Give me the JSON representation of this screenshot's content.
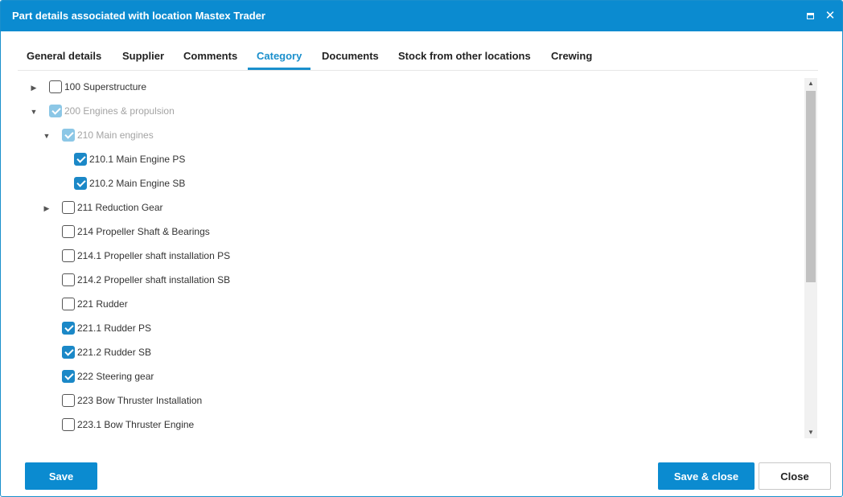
{
  "window": {
    "title": "Part details associated with location Mastex Trader",
    "maximize_icon": "maximize-icon",
    "close_icon": "close-icon",
    "close_glyph": "✕"
  },
  "tabs": [
    {
      "label": "General details",
      "active": false
    },
    {
      "label": "Supplier",
      "active": false
    },
    {
      "label": "Comments",
      "active": false
    },
    {
      "label": "Category",
      "active": true
    },
    {
      "label": "Documents",
      "active": false
    },
    {
      "label": "Stock from other locations",
      "active": false
    },
    {
      "label": "Crewing",
      "active": false
    }
  ],
  "tree": {
    "expand_glyph_collapsed": "▶",
    "expand_glyph_expanded": "▼",
    "items": [
      {
        "label": "100 Superstructure",
        "checked": false,
        "disabled": false,
        "expander": "collapsed"
      },
      {
        "label": "200 Engines & propulsion",
        "checked": true,
        "disabled": true,
        "expander": "expanded"
      },
      {
        "label": "210 Main engines",
        "checked": true,
        "disabled": true,
        "expander": "expanded"
      },
      {
        "label": "210.1 Main Engine PS",
        "checked": true,
        "disabled": false,
        "expander": "none"
      },
      {
        "label": "210.2 Main Engine SB",
        "checked": true,
        "disabled": false,
        "expander": "none"
      },
      {
        "label": "211 Reduction Gear",
        "checked": false,
        "disabled": false,
        "expander": "collapsed"
      },
      {
        "label": "214 Propeller Shaft & Bearings",
        "checked": false,
        "disabled": false,
        "expander": "none"
      },
      {
        "label": "214.1 Propeller shaft installation PS",
        "checked": false,
        "disabled": false,
        "expander": "none"
      },
      {
        "label": "214.2 Propeller shaft installation SB",
        "checked": false,
        "disabled": false,
        "expander": "none"
      },
      {
        "label": "221 Rudder",
        "checked": false,
        "disabled": false,
        "expander": "none"
      },
      {
        "label": "221.1 Rudder PS",
        "checked": true,
        "disabled": false,
        "expander": "none"
      },
      {
        "label": "221.2 Rudder SB",
        "checked": true,
        "disabled": false,
        "expander": "none"
      },
      {
        "label": "222 Steering gear",
        "checked": true,
        "disabled": false,
        "expander": "none"
      },
      {
        "label": "223 Bow Thruster Installation",
        "checked": false,
        "disabled": false,
        "expander": "none"
      },
      {
        "label": "223.1 Bow Thruster Engine",
        "checked": false,
        "disabled": false,
        "expander": "none"
      }
    ]
  },
  "scrollbar": {
    "up_glyph": "▲",
    "down_glyph": "▼"
  },
  "footer": {
    "save_label": "Save",
    "save_close_label": "Save & close",
    "close_label": "Close"
  },
  "colors": {
    "accent": "#0b8bd0",
    "checkbox_checked": "#1b88c7",
    "checkbox_checked_disabled": "#8cc7e6",
    "disabled_text": "#a4a4a4"
  }
}
